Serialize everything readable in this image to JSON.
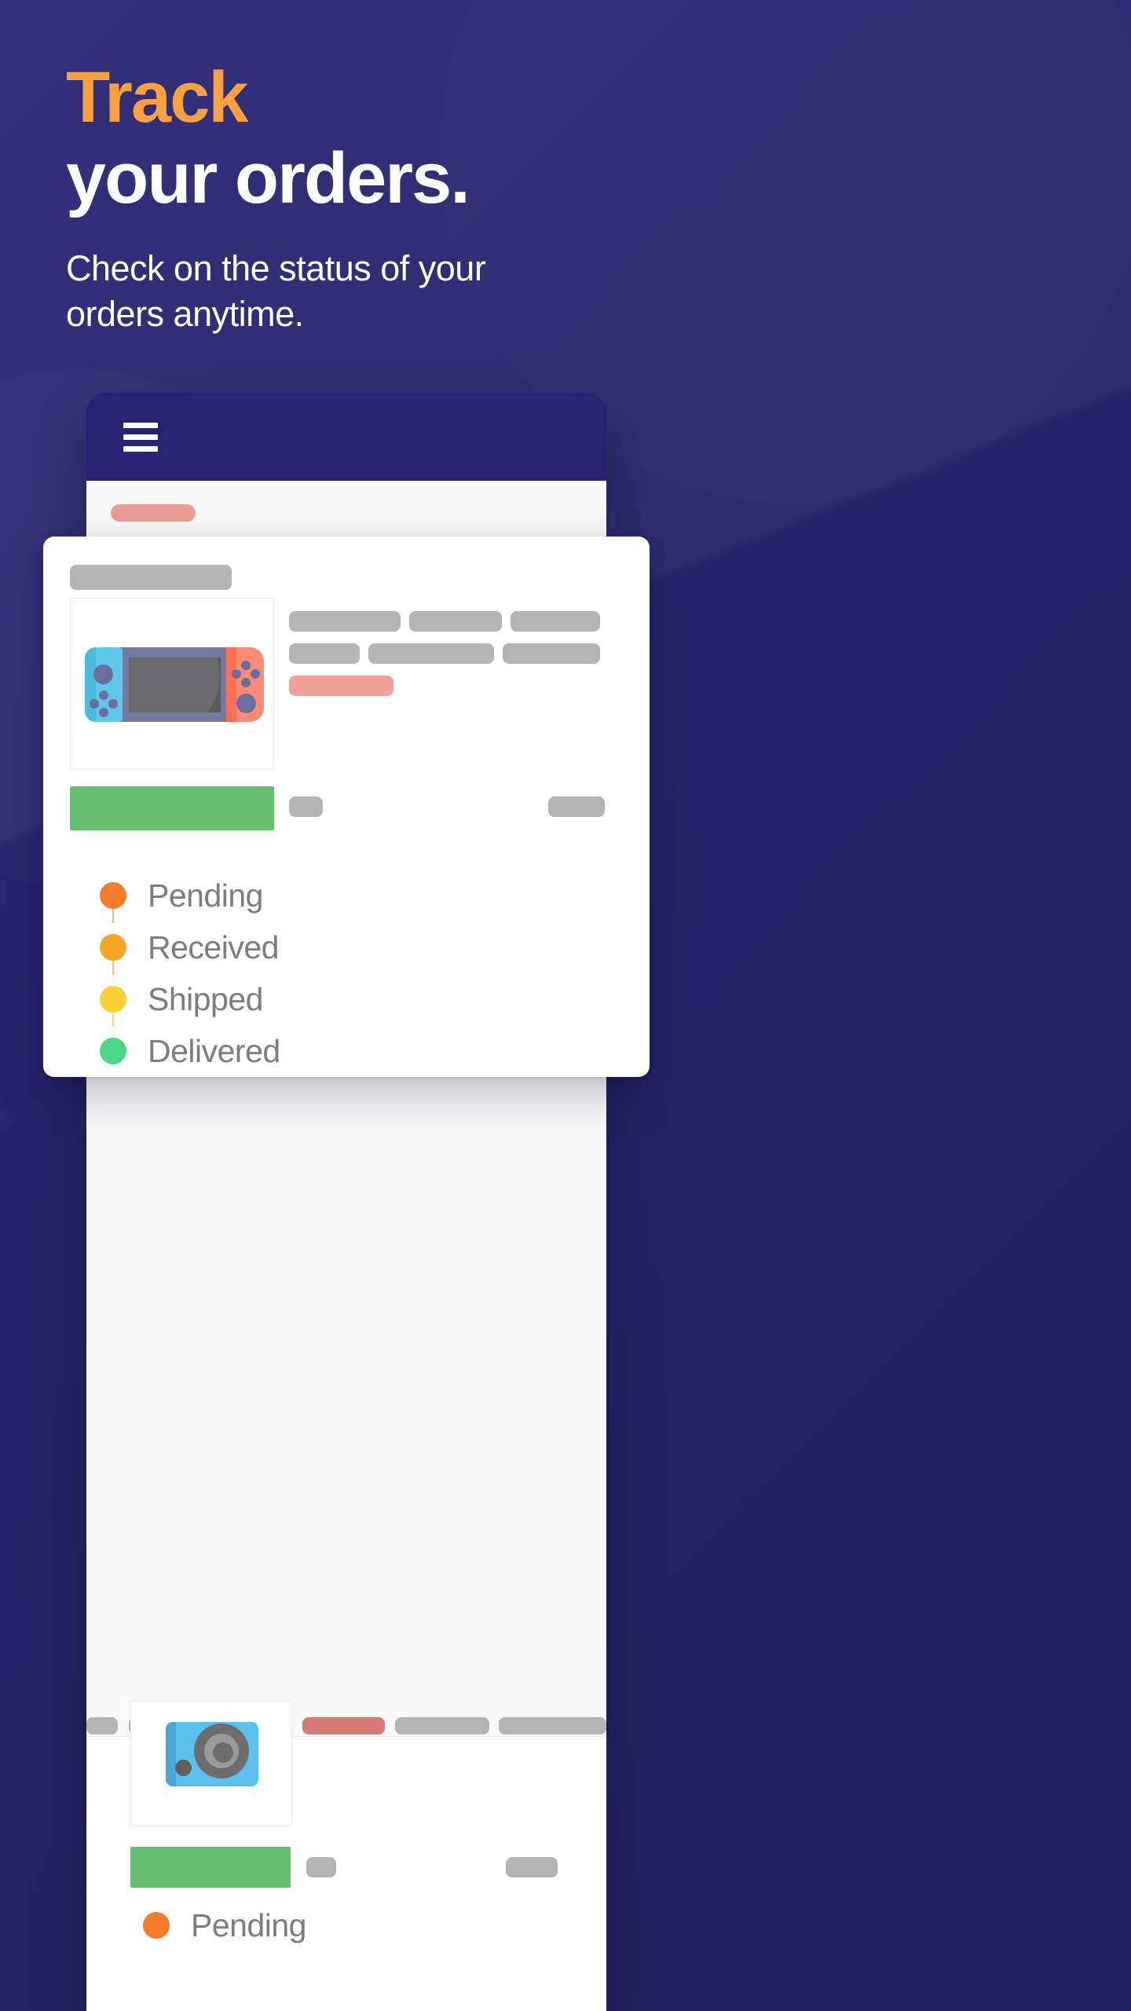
{
  "hero": {
    "title_accent": "Track",
    "title_main": "your orders.",
    "subtitle": "Check on the status of your orders anytime."
  },
  "colors": {
    "background": "#26236b",
    "accent_orange": "#f9a03f",
    "appbar": "#272372",
    "text_light": "#ffffff",
    "status_pending": "#f47b2b",
    "status_received": "#f5a623",
    "status_shipped": "#fcd033",
    "status_delivered": "#4cd787",
    "placeholder_gray": "#b4b4b4",
    "placeholder_pink": "#f2a09b",
    "button_green": "#66bf6f",
    "joycon_left": "#5ec8ea",
    "joycon_right": "#fd8a73",
    "camera_blue": "#5cc0ef"
  },
  "phone": {
    "appbar": {
      "menu_icon": "hamburger-menu-icon"
    }
  },
  "order_card": {
    "product_image": "nintendo-switch-illustration",
    "statuses": [
      {
        "label": "Pending",
        "color": "#f47b2b"
      },
      {
        "label": "Received",
        "color": "#f5a623"
      },
      {
        "label": "Shipped",
        "color": "#fcd033"
      },
      {
        "label": "Delivered",
        "color": "#4cd787"
      }
    ]
  },
  "second_order_card": {
    "product_image": "camera-illustration",
    "statuses": [
      {
        "label": "Pending",
        "color": "#f47b2b"
      }
    ]
  }
}
